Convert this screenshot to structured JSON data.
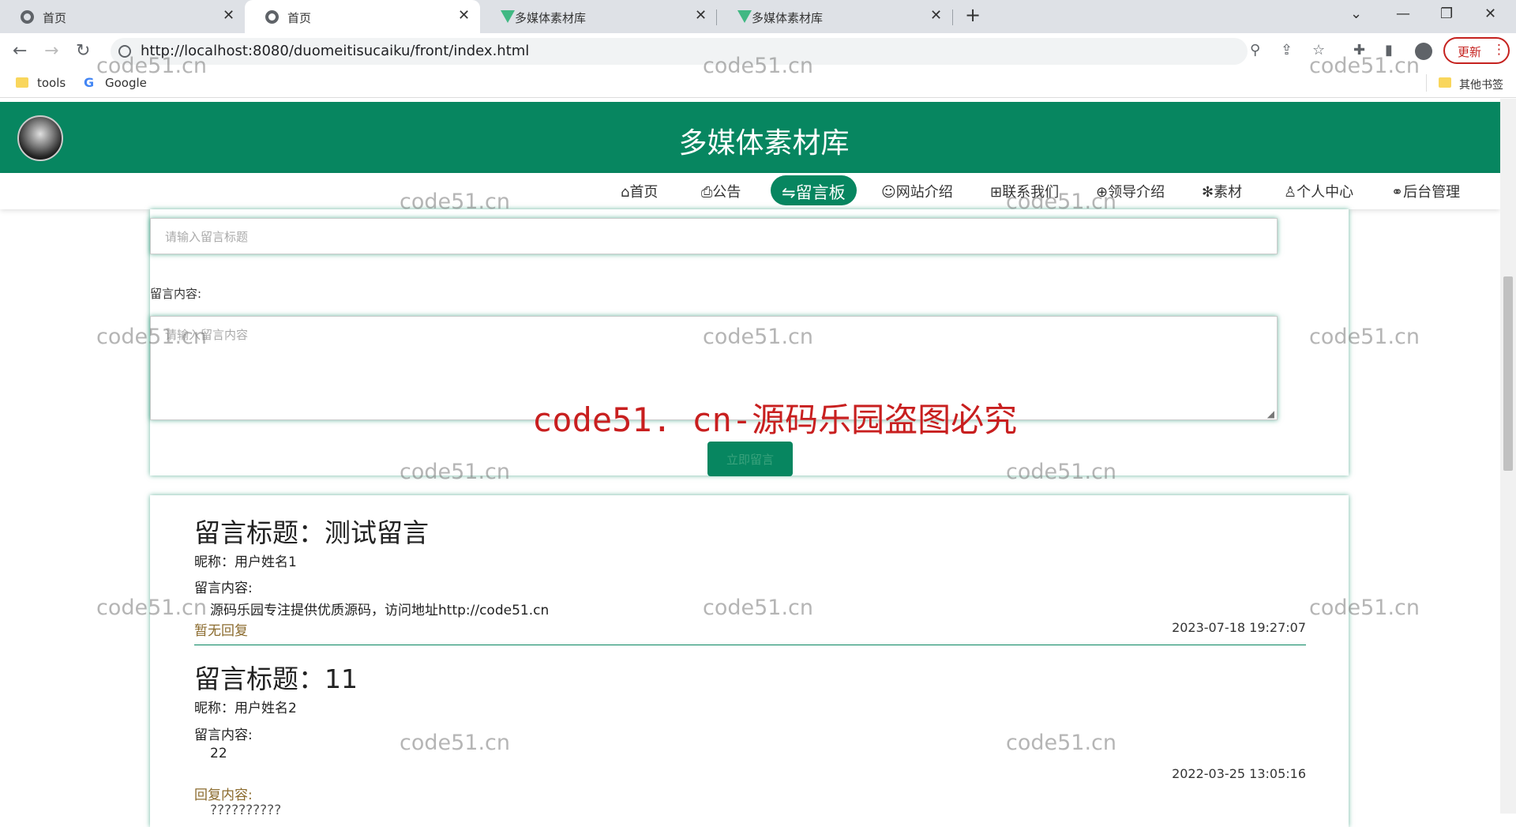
{
  "browser": {
    "tabs": [
      {
        "title": "首页",
        "icon": "globe-icon",
        "active": false
      },
      {
        "title": "首页",
        "icon": "globe-icon",
        "active": true
      },
      {
        "title": "多媒体素材库",
        "icon": "vue-icon",
        "active": false
      },
      {
        "title": "多媒体素材库",
        "icon": "vue-icon",
        "active": false
      }
    ],
    "url": "http://localhost:8080/duomeitisucaiku/front/index.html",
    "update_label": "更新",
    "bookmarks": [
      {
        "label": "tools",
        "icon": "folder-icon"
      },
      {
        "label": "Google",
        "icon": "google-icon"
      }
    ],
    "other_bookmarks": "其他书签"
  },
  "site": {
    "title": "多媒体素材库",
    "accent": "#078660",
    "nav": [
      {
        "icon": "home-icon",
        "label": "首页",
        "active": false
      },
      {
        "icon": "notice-icon",
        "label": "公告",
        "active": false
      },
      {
        "icon": "message-board-icon",
        "label": "留言板",
        "active": true
      },
      {
        "icon": "website-icon",
        "label": "网站介绍",
        "active": false
      },
      {
        "icon": "contact-icon",
        "label": "联系我们",
        "active": false
      },
      {
        "icon": "leader-icon",
        "label": "领导介绍",
        "active": false
      },
      {
        "icon": "material-icon",
        "label": "素材",
        "active": false
      },
      {
        "icon": "user-icon",
        "label": "个人中心",
        "active": false
      },
      {
        "icon": "link-icon",
        "label": "后台管理",
        "active": false
      }
    ]
  },
  "form": {
    "title_placeholder": "请输入留言标题",
    "content_label": "留言内容:",
    "content_placeholder": "请输入留言内容",
    "submit_label": "立即留言"
  },
  "messages": [
    {
      "title": "留言标题：测试留言",
      "nickname": "昵称：用户姓名1",
      "content_label": "留言内容:",
      "content": "源码乐园专注提供优质源码，访问地址http://code51.cn",
      "reply": "暂无回复",
      "date": "2023-07-18 19:27:07"
    },
    {
      "title": "留言标题：11",
      "nickname": "昵称：用户姓名2",
      "content_label": "留言内容:",
      "content": "22",
      "date": "2022-03-25 13:05:16",
      "reply_label": "回复内容:",
      "reply_content": "??????????"
    }
  ],
  "watermarks": {
    "small": "code51.cn",
    "banner": "code51. cn-源码乐园盗图必究"
  }
}
